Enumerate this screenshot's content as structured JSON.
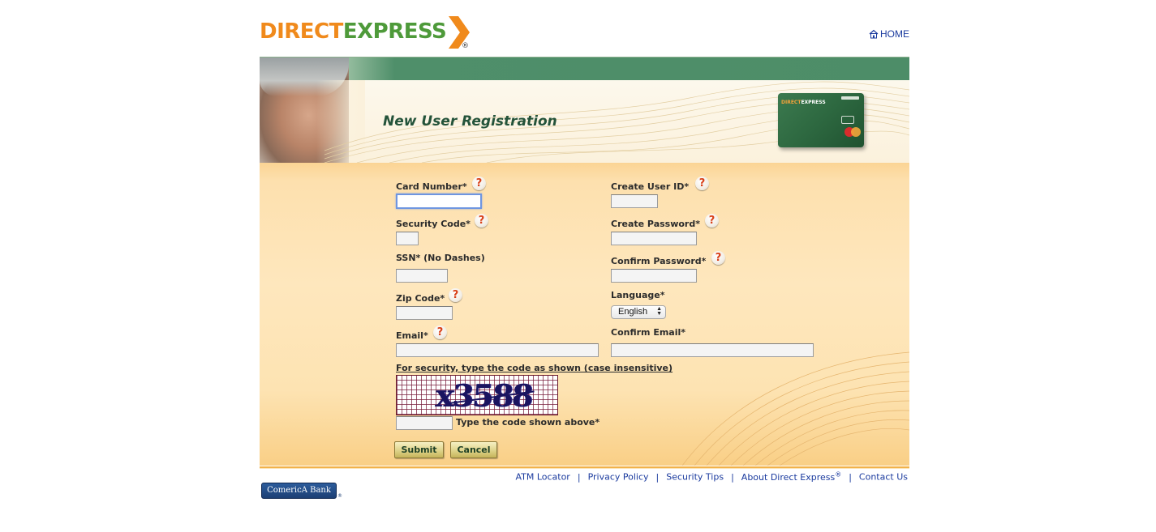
{
  "header": {
    "logo": {
      "part1": "DIRECT",
      "part2": "EXPRESS",
      "registered": "®"
    },
    "home_link": "HOME"
  },
  "banner": {
    "title": "New User Registration",
    "card": {
      "brand1": "DIRECT",
      "brand2": "EXPRESS"
    }
  },
  "colors": {
    "logo_orange": "#f08a1c",
    "logo_green": "#4e9a3a",
    "banner_green": "#4d8d68",
    "title_green": "#24533a",
    "link_blue": "#1a3a9e",
    "help_red": "#d9411a"
  },
  "form": {
    "left": [
      {
        "label": "Card Number*",
        "help": true,
        "value": "",
        "focused": true
      },
      {
        "label": "Security Code*",
        "help": true,
        "value": ""
      },
      {
        "label": "SSN* (No Dashes)",
        "help": false,
        "value": ""
      },
      {
        "label": "Zip Code*",
        "help": true,
        "value": ""
      },
      {
        "label": "Email*",
        "help": true,
        "value": ""
      }
    ],
    "right": [
      {
        "label": "Create User ID*",
        "help": true,
        "value": ""
      },
      {
        "label": "Create Password*",
        "help": true,
        "value": ""
      },
      {
        "label": "Confirm Password*",
        "help": true,
        "value": ""
      },
      {
        "label": "Language*",
        "help": false
      },
      {
        "label": "Confirm Email*",
        "help": false,
        "value": ""
      }
    ],
    "language_selected": "English",
    "help_glyph": "?",
    "captcha": {
      "instruction": "For security, type the code as shown (case insensitive)",
      "code_image_text": "x3588",
      "input_label": "Type the code shown above*",
      "value": ""
    },
    "buttons": {
      "submit": "Submit",
      "cancel": "Cancel"
    }
  },
  "footer": {
    "links": [
      "ATM Locator",
      "Privacy Policy",
      "Security Tips",
      "About Direct Express",
      "Contact Us"
    ],
    "about_sup": "®",
    "separator": "|",
    "sponsor": "ComericA Bank",
    "sponsor_reg": "®"
  }
}
